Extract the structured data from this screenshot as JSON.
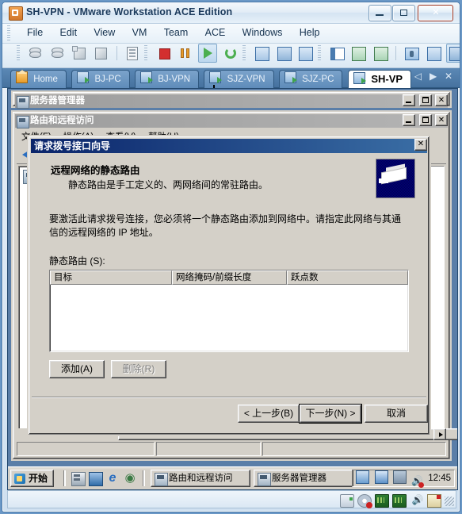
{
  "window": {
    "title": "SH-VPN - VMware Workstation ACE Edition",
    "app_icon": "vmware-icon",
    "minimize": "–",
    "maximize": "□",
    "close": "✕"
  },
  "menu": {
    "items": [
      {
        "label": "File"
      },
      {
        "label": "Edit"
      },
      {
        "label": "View"
      },
      {
        "label": "VM"
      },
      {
        "label": "Team"
      },
      {
        "label": "ACE"
      },
      {
        "label": "Windows"
      },
      {
        "label": "Help"
      }
    ]
  },
  "toolbar": {
    "buttons": [
      {
        "name": "new-virtual-machine",
        "icon": "disks-icon"
      },
      {
        "name": "new-team",
        "icon": "disks-icon"
      },
      {
        "name": "power-on-snapshot",
        "icon": "cube-star-icon"
      },
      {
        "name": "new-ace-package",
        "icon": "package-icon"
      },
      {
        "name": "open",
        "icon": "document-icon"
      },
      {
        "name": "power-off",
        "icon": "stop-icon"
      },
      {
        "name": "suspend",
        "icon": "pause-icon"
      },
      {
        "name": "power-on",
        "icon": "play-icon"
      },
      {
        "name": "reset",
        "icon": "reset-icon"
      },
      {
        "name": "snapshot",
        "icon": "snapshot-icon"
      },
      {
        "name": "revert-snapshot",
        "icon": "revert-icon"
      },
      {
        "name": "snapshot-manager",
        "icon": "snapshot-manager-icon"
      },
      {
        "name": "show-sidebar",
        "icon": "sidebar-icon"
      },
      {
        "name": "quick-switch",
        "icon": "quick-switch-icon"
      },
      {
        "name": "full-screen",
        "icon": "fullscreen-icon"
      },
      {
        "name": "settings",
        "icon": "wrench-icon"
      },
      {
        "name": "summary",
        "icon": "summary-icon"
      },
      {
        "name": "console-view",
        "icon": "console-icon"
      }
    ]
  },
  "tabs": {
    "items": [
      {
        "label": "Home",
        "icon": "home-icon",
        "active": false
      },
      {
        "label": "BJ-PC",
        "icon": "vm-icon",
        "active": false
      },
      {
        "label": "BJ-VPN",
        "icon": "vm-icon",
        "active": false
      },
      {
        "label": "SJZ-VPN",
        "icon": "vm-icon",
        "active": false
      },
      {
        "label": "SJZ-PC",
        "icon": "vm-icon",
        "active": false
      },
      {
        "label": "SH-VP",
        "icon": "vm-icon",
        "active": true
      }
    ],
    "nav": {
      "prev": "◁",
      "next": "▶",
      "close": "✕"
    }
  },
  "guest": {
    "server_manager_window": {
      "title": "服务器管理器",
      "minimize": "_",
      "maximize": "□",
      "close": "✕"
    },
    "rras_window": {
      "title": "路由和远程访问",
      "minimize": "_",
      "maximize": "□",
      "close": "✕",
      "menu": [
        {
          "label": "文件(F)"
        },
        {
          "label": "操作(A)"
        },
        {
          "label": "查看(V)"
        },
        {
          "label": "帮助(H)"
        }
      ]
    },
    "wizard": {
      "title": "请求拨号接口向导",
      "close": "✕",
      "heading": "远程网络的静态路由",
      "subheading": "静态路由是手工定义的、两网络间的常驻路由。",
      "icon": "router-icon",
      "body": "要激活此请求拨号连接，您必须将一个静态路由添加到网络中。请指定此网络与其通信的远程网络的 IP 地址。",
      "list_label": "静态路由 (S):",
      "columns": [
        {
          "label": "目标"
        },
        {
          "label": "网络掩码/前缀长度"
        },
        {
          "label": "跃点数"
        }
      ],
      "rows": [],
      "add_button": "添加(A)",
      "delete_button": "删除(R)",
      "back_button": "< 上一步(B)",
      "next_button": "下一步(N) >",
      "cancel_button": "取消"
    },
    "taskbar": {
      "start": "开始",
      "quick_launch": [
        {
          "name": "server-manager-icon"
        },
        {
          "name": "show-desktop-icon"
        },
        {
          "name": "internet-explorer-icon"
        },
        {
          "name": "browser-icon"
        }
      ],
      "tasks": [
        {
          "label": "路由和远程访问",
          "icon": "rras-icon"
        },
        {
          "label": "服务器管理器",
          "icon": "server-manager-icon"
        }
      ],
      "tray_icons": [
        {
          "name": "network-icon"
        },
        {
          "name": "network-connections-icon"
        },
        {
          "name": "display-icon"
        },
        {
          "name": "volume-muted-icon"
        }
      ],
      "time": "12:45"
    }
  },
  "vm_status": {
    "devices": [
      {
        "name": "hard-disk-icon"
      },
      {
        "name": "cd-dvd-disconnected-icon"
      },
      {
        "name": "network-adapter-1-icon"
      },
      {
        "name": "network-adapter-2-icon"
      },
      {
        "name": "sound-icon"
      },
      {
        "name": "shared-folders-icon"
      }
    ]
  },
  "colors": {
    "vmware_chrome": "#d9e7f3",
    "tabstrip": "#4f7da9",
    "classic_face": "#d4d0c8",
    "classic_title_active": "#0a246a",
    "desktop": "#5a7ea8",
    "close_red": "#c23b28"
  }
}
